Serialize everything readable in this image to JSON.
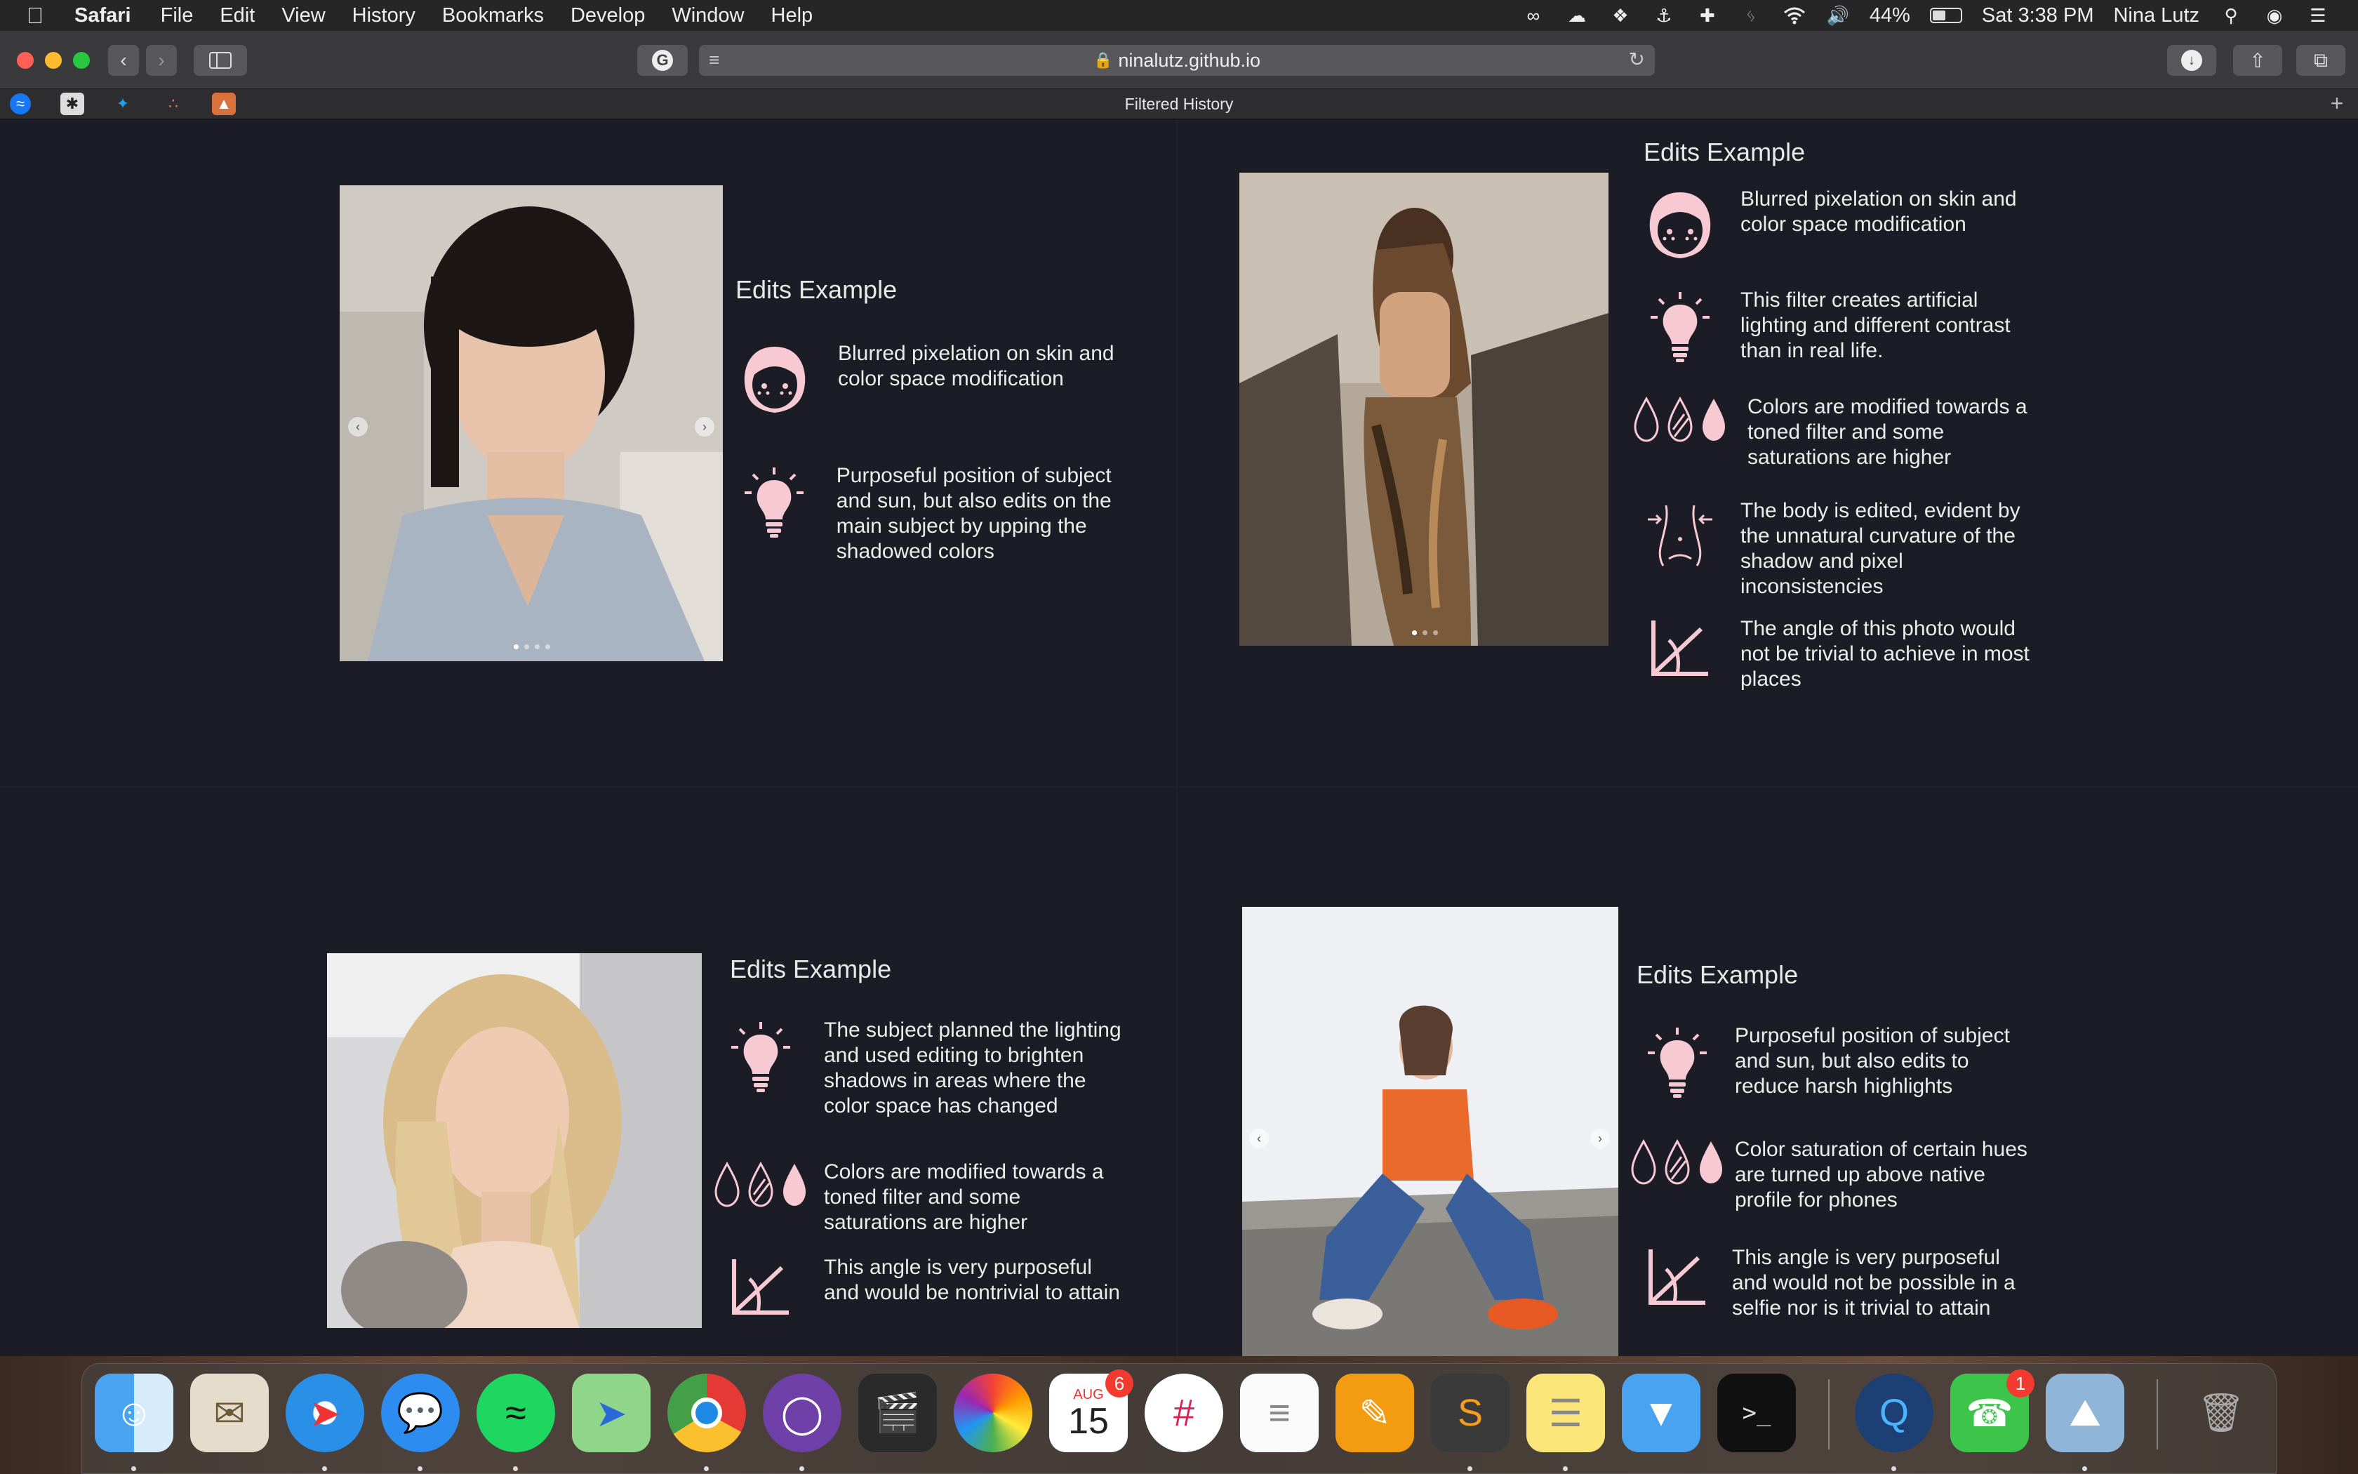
{
  "menubar": {
    "app": "Safari",
    "items": [
      "File",
      "Edit",
      "View",
      "History",
      "Bookmarks",
      "Develop",
      "Window",
      "Help"
    ],
    "battery": "44%",
    "clock": "Sat 3:38 PM",
    "user": "Nina Lutz"
  },
  "browser": {
    "url": "ninalutz.github.io",
    "tab_title": "Filtered History"
  },
  "panels": [
    {
      "title": "Edits Example",
      "edits": [
        {
          "icon": "face-icon",
          "text": "Blurred pixelation on skin and color space modification"
        },
        {
          "icon": "lightbulb-icon",
          "text": "Purposeful position of subject and sun, but also edits on the main subject by upping the shadowed colors"
        }
      ]
    },
    {
      "title": "Edits Example",
      "edits": [
        {
          "icon": "face-icon",
          "text": "Blurred pixelation on skin and color space modification"
        },
        {
          "icon": "lightbulb-icon",
          "text": "This filter creates artificial lighting and different contrast than in real life."
        },
        {
          "icon": "drops-icon",
          "text": "Colors are modified towards a toned filter and some saturations are higher"
        },
        {
          "icon": "body-icon",
          "text": "The body is edited, evident by the unnatural curvature of the shadow and pixel inconsistencies"
        },
        {
          "icon": "angle-icon",
          "text": "The angle of this photo would not be trivial to achieve in most places"
        }
      ]
    },
    {
      "title": "Edits Example",
      "edits": [
        {
          "icon": "lightbulb-icon",
          "text": "The subject planned the lighting and used editing to brighten shadows in areas where the color space has changed"
        },
        {
          "icon": "drops-icon",
          "text": "Colors are modified towards a toned filter and some saturations are higher"
        },
        {
          "icon": "angle-icon",
          "text": "This angle is very purposeful and would be nontrivial to attain"
        }
      ]
    },
    {
      "title": "Edits Example",
      "edits": [
        {
          "icon": "lightbulb-icon",
          "text": "Purposeful position of subject and sun, but also edits to reduce harsh highlights"
        },
        {
          "icon": "drops-icon",
          "text": "Color saturation of certain hues are turned up above native profile for phones"
        },
        {
          "icon": "angle-icon",
          "text": "This angle is very purposeful and would not be possible in a selfie nor is it trivial to attain"
        }
      ]
    }
  ],
  "dock": {
    "calendar_month": "AUG",
    "calendar_day": "15",
    "calendar_badge": "6",
    "facetime_badge": "1"
  },
  "colors": {
    "page_bg": "#1b1c25",
    "icon_pink": "#f6c9d3"
  }
}
